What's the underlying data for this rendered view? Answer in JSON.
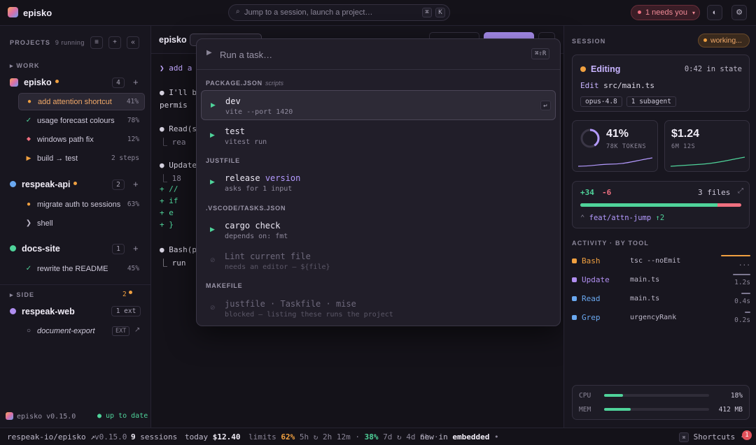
{
  "app": {
    "name": "episko"
  },
  "top": {
    "search_placeholder": "Jump to a session, launch a project…",
    "search_kbd1": "⌘",
    "search_kbd2": "K",
    "needs_you": "1 needs you",
    "needs_caret": "▾",
    "theme_icon": "◐",
    "settings_icon": "⚙"
  },
  "sidebar": {
    "projects_label": "PROJECTS",
    "running": "9 running",
    "btn_list": "≡",
    "btn_add": "+",
    "btn_collapse": "«",
    "work_label": "WORK",
    "side_label": "SIDE",
    "side_count": "2",
    "projects": [
      {
        "name": "episko",
        "count": "4",
        "color": "#f0a040",
        "sessions": [
          {
            "label": "add attention shortcut",
            "pct": "41%",
            "status": "●",
            "status_color": "#f0a040"
          },
          {
            "label": "usage forecast colours",
            "pct": "78%",
            "status": "✓",
            "status_color": "#4fd39a"
          },
          {
            "label": "windows path fix",
            "pct": "12%",
            "status": "◆",
            "status_color": "#f07080"
          },
          {
            "label": "build → test",
            "pct": "2 steps",
            "status": "▶",
            "status_color": "#f0a040"
          }
        ]
      },
      {
        "name": "respeak-api",
        "count": "2",
        "color": "#6aa8f0",
        "sessions": [
          {
            "label": "migrate auth to sessions",
            "pct": "63%",
            "status": "●",
            "status_color": "#f0a040"
          },
          {
            "label": "shell",
            "pct": "",
            "status": "❯",
            "status_color": "#bdb8c9"
          }
        ]
      },
      {
        "name": "docs-site",
        "count": "1",
        "color": "#4fd39a",
        "sessions": [
          {
            "label": "rewrite the README",
            "pct": "45%",
            "status": "✓",
            "status_color": "#4fd39a"
          }
        ]
      },
      {
        "name": "respeak-web",
        "count": "1 ext",
        "color": "#b08ef0",
        "sessions": [
          {
            "label": "document-export",
            "pct": "EXT",
            "status": "○",
            "status_color": "#9a95a8"
          }
        ]
      }
    ],
    "version": "episko v0.15.0",
    "up_to_date": "● up to date"
  },
  "center": {
    "project": "episko",
    "lines": [
      {
        "text": "❯ add a",
        "color": "#dcd8e6"
      },
      {
        "text": "● I'll b",
        "color": "#dcd8e6"
      },
      {
        "text": "  permis",
        "color": "#dcd8e6"
      },
      {
        "text": "● Read(s",
        "color": "#dcd8e6"
      },
      {
        "text": "  ⎿ rea",
        "color": "#8a8597"
      },
      {
        "text": "● Update",
        "color": "#dcd8e6"
      },
      {
        "text": "  ⎿ 18",
        "color": "#8a8597"
      },
      {
        "text": "    + //",
        "color": "#4fd39a"
      },
      {
        "text": "    + if",
        "color": "#4fd39a"
      },
      {
        "text": "    +  e",
        "color": "#4fd39a"
      },
      {
        "text": "    + }",
        "color": "#4fd39a"
      },
      {
        "text": "● Bash(p",
        "color": "#dcd8e6"
      },
      {
        "text": "  ⎿ run",
        "color": "#dcd8e6"
      }
    ]
  },
  "palette": {
    "placeholder": "Run a task…",
    "shortcut": "⌘⇧R",
    "groups": [
      {
        "name": "PACKAGE.JSON",
        "note": "scripts",
        "tasks": [
          {
            "name": "dev",
            "sub": "vite --port 1420",
            "enter": "↵"
          },
          {
            "name": "test",
            "sub": "vitest run"
          }
        ]
      },
      {
        "name": "JUSTFILE",
        "note": "",
        "tasks": [
          {
            "name": "release",
            "param": "version",
            "sub": "asks for 1 input"
          }
        ]
      },
      {
        "name": ".VSCODE/TASKS.JSON",
        "note": "",
        "tasks": [
          {
            "name": "cargo check",
            "sub": "depends on: fmt"
          },
          {
            "name": "Lint current file",
            "sub": "needs an editor — ${file}"
          }
        ]
      },
      {
        "name": "MAKEFILE",
        "note": "",
        "tasks": [
          {
            "name": "justfile · Taskfile · mise",
            "sub": "blocked — listing these runs the project"
          }
        ]
      }
    ]
  },
  "right": {
    "session_label": "SESSION",
    "working": "working...",
    "state": "Editing",
    "state_time": "0:42 in state",
    "editing_label": "Edit",
    "editing_file": "src/main.ts",
    "tag_model": "opus-4.8",
    "tag_sub": "1 subagent",
    "context_pct": "41%",
    "context_fraction": 0.41,
    "tokens": "78K TOKENS",
    "cost": "$1.24",
    "cost_time": "6M 12S",
    "added": "+34",
    "removed": "-6",
    "files": "3 files",
    "diff_add_fraction": 0.85,
    "branch": "feat/attn-jump",
    "branch_ahead": "↑2",
    "activity_label": "ACTIVITY · BY TOOL",
    "activity": [
      {
        "tool": "Bash",
        "target": "tsc --noEmit",
        "time": "...",
        "color": "#f0a040",
        "fraction": 1.0
      },
      {
        "tool": "Update",
        "target": "main.ts",
        "time": "1.2s",
        "color": "#b08ef0",
        "fraction": 0.6
      },
      {
        "tool": "Read",
        "target": "main.ts",
        "time": "0.4s",
        "color": "#6aa8f0",
        "fraction": 0.3
      },
      {
        "tool": "Grep",
        "target": "urgencyRank",
        "time": "0.2s",
        "color": "#6aa8f0",
        "fraction": 0.2
      }
    ],
    "cpu_label": "CPU",
    "cpu_value": "18%",
    "cpu_fraction": 0.18,
    "mem_label": "MEM",
    "mem_value": "412 MB",
    "mem_fraction": 0.25
  },
  "status": {
    "repo": "respeak-io/episko ↗",
    "version": "v0.15.0",
    "sessions_num": "9",
    "sessions_word": "sessions",
    "today_label": "today",
    "today_cost": "$12.40",
    "limits_label": "limits",
    "limit1_pct": "62%",
    "limit1_rest": "5h ↻ 2h 12m ·",
    "limit2_pct": "38%",
    "limit2_rest": "7d ↻ 4d 6h ·",
    "new_in": "new in",
    "embedded": "embedded",
    "embedded_dot": "•",
    "shortcuts_icon": "⌘",
    "shortcuts": "Shortcuts ·",
    "bug_count": "1"
  }
}
